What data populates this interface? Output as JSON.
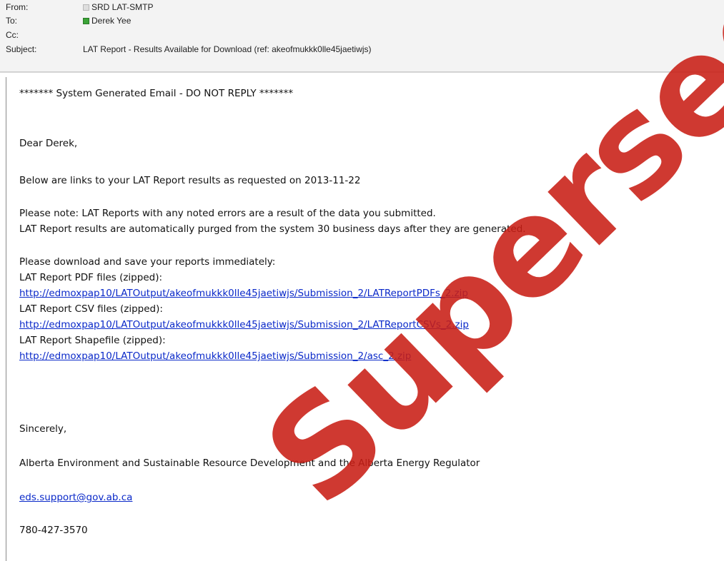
{
  "header": {
    "from_label": "From:",
    "from_value": "SRD LAT-SMTP",
    "to_label": "To:",
    "to_value": "Derek Yee",
    "cc_label": "Cc:",
    "cc_value": "",
    "subject_label": "Subject:",
    "subject_value": "LAT Report - Results Available for Download  (ref: akeofmukkk0lle45jaetiwjs)"
  },
  "body": {
    "banner": "******* System Generated Email - DO NOT REPLY *******",
    "greeting": "Dear Derek,",
    "intro": "Below are links to your LAT Report results as requested on 2013-11-22",
    "note_1": "Please note: LAT Reports with any noted errors are a result of the data you submitted.",
    "note_2": "LAT Report results are automatically purged from the system 30 business days after they are generated.",
    "download_prompt": "Please download and save your reports immediately:",
    "pdf_label": "LAT Report PDF files (zipped):",
    "pdf_link": "http://edmoxpap10/LATOutput/akeofmukkk0lle45jaetiwjs/Submission_2/LATReportPDFs_2.zip",
    "csv_label": "LAT Report CSV files (zipped):",
    "csv_link": "http://edmoxpap10/LATOutput/akeofmukkk0lle45jaetiwjs/Submission_2/LATReportCSVs_2.zip",
    "shape_label": "LAT Report Shapefile (zipped):",
    "shape_link": "http://edmoxpap10/LATOutput/akeofmukkk0lle45jaetiwjs/Submission_2/asc_2.zip",
    "closing": "Sincerely,",
    "signature": "Alberta Environment and Sustainable Resource Development and the Alberta Energy Regulator",
    "email": "eds.support@gov.ab.ca",
    "phone": "780-427-3570"
  },
  "watermark": {
    "text": "Superseded",
    "color": "#c81e14"
  },
  "colors": {
    "link": "#0a29c9",
    "header_bg": "#f3f3f3",
    "presence_online": "#3aa336"
  }
}
